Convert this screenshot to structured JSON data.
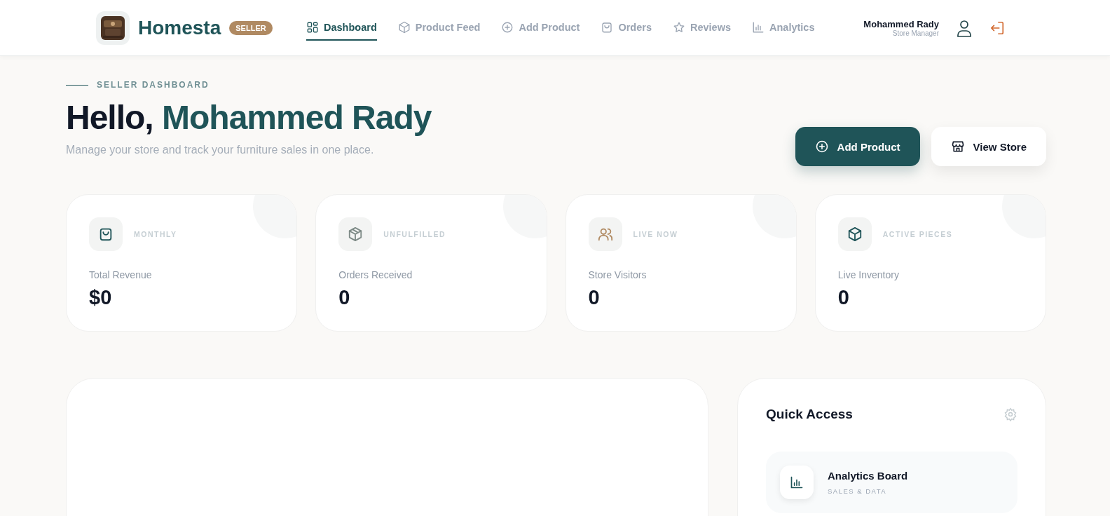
{
  "header": {
    "brand": "Homesta",
    "badge": "SELLER",
    "nav": [
      {
        "label": "Dashboard",
        "kind": "grid",
        "selected": true
      },
      {
        "label": "Product Feed",
        "kind": "box",
        "selected": false
      },
      {
        "label": "Add Product",
        "kind": "plus",
        "selected": false
      },
      {
        "label": "Orders",
        "kind": "bag",
        "selected": false
      },
      {
        "label": "Reviews",
        "kind": "star",
        "selected": false
      },
      {
        "label": "Analytics",
        "kind": "chart",
        "selected": false
      }
    ],
    "user": {
      "name": "Mohammed Rady",
      "role": "Store Manager"
    }
  },
  "hero": {
    "eyebrow": "SELLER DASHBOARD",
    "greeting": "Hello,",
    "name": "Mohammed Rady",
    "subtitle": "Manage your store and track your furniture sales in one place.",
    "actions": [
      {
        "label": "Add Product",
        "kind": "primary"
      },
      {
        "label": "View Store",
        "kind": "secondary"
      }
    ]
  },
  "stats": [
    {
      "tag": "MONTHLY",
      "label": "Total Revenue",
      "value": "$0",
      "kind": "bag"
    },
    {
      "tag": "UNFULFILLED",
      "label": "Orders Received",
      "value": "0",
      "kind": "box"
    },
    {
      "tag": "LIVE NOW",
      "label": "Store Visitors",
      "value": "0",
      "kind": "users"
    },
    {
      "tag": "ACTIVE PIECES",
      "label": "Live Inventory",
      "value": "0",
      "kind": "cube"
    }
  ],
  "quick_access": {
    "title": "Quick Access",
    "items": [
      {
        "title": "Analytics Board",
        "subtitle": "SALES & DATA",
        "kind": "chart"
      }
    ]
  }
}
